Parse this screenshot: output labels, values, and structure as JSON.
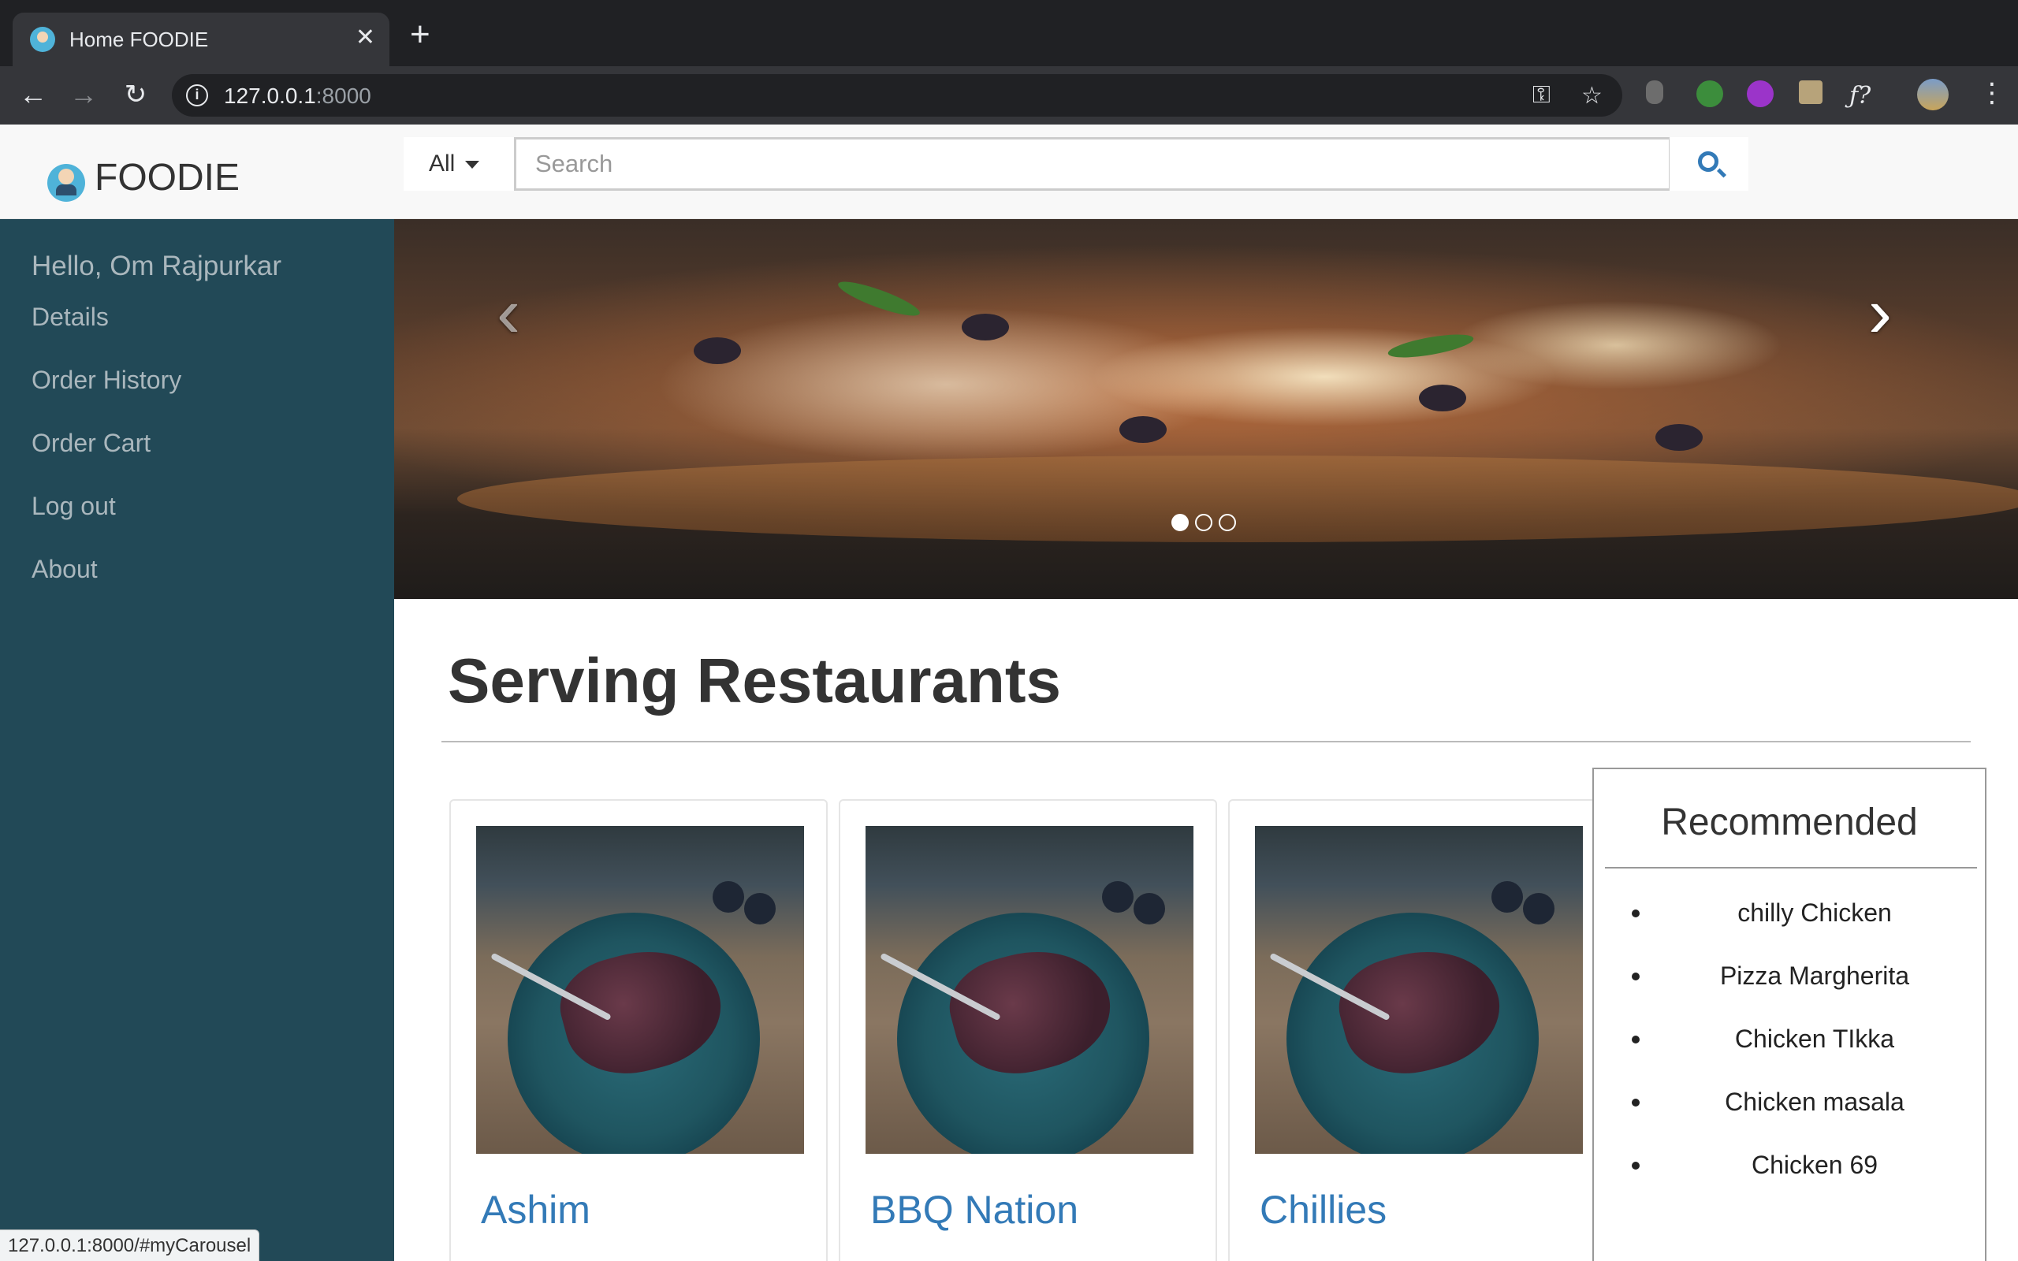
{
  "browser": {
    "tab_title": "Home FOODIE",
    "tab_close": "✕",
    "new_tab": "+",
    "url_host": "127.0.0.1",
    "url_port": ":8000",
    "status_url": "127.0.0.1:8000/#myCarousel"
  },
  "header": {
    "brand": "FOODIE",
    "search_category": "All",
    "search_placeholder": "Search"
  },
  "sidebar": {
    "greeting": "Hello, Om Rajpurkar",
    "items": [
      {
        "label": "Details"
      },
      {
        "label": "Order History"
      },
      {
        "label": "Order Cart"
      },
      {
        "label": "Log out"
      },
      {
        "label": "About"
      }
    ]
  },
  "carousel": {
    "slide_count": 3,
    "active_index": 0,
    "prev_icon": "‹",
    "next_icon": "›"
  },
  "main": {
    "section_title": "Serving Restaurants",
    "restaurants": [
      {
        "name": "Ashim"
      },
      {
        "name": "BBQ Nation"
      },
      {
        "name": "Chillies"
      }
    ]
  },
  "recommended": {
    "title": "Recommended",
    "items": [
      "chilly Chicken",
      "Pizza Margherita",
      "Chicken TIkka",
      "Chicken masala",
      "Chicken 69"
    ]
  },
  "colors": {
    "sidebar_bg": "#224957",
    "link": "#337ab7",
    "header_bg": "#f8f8f8"
  }
}
